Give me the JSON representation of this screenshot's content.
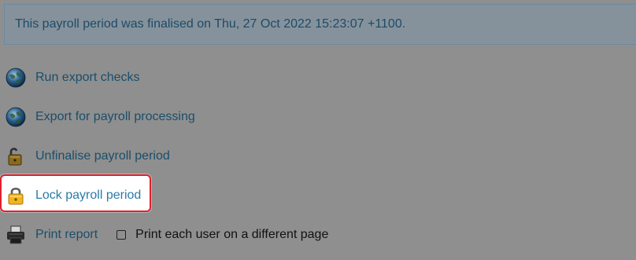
{
  "notice": {
    "text": "This payroll period was finalised on Thu, 27 Oct 2022 15:23:07 +1100."
  },
  "actions": [
    {
      "label": "Run export checks",
      "icon": "globe-icon"
    },
    {
      "label": "Export for payroll processing",
      "icon": "globe-icon"
    },
    {
      "label": "Unfinalise payroll period",
      "icon": "unlocked-padlock-icon"
    },
    {
      "label": "Lock payroll period",
      "icon": "locked-padlock-icon"
    },
    {
      "label": "Print report",
      "icon": "printer-icon"
    }
  ],
  "print_option": {
    "label": "Print each user on a different page",
    "checked": false
  },
  "colors": {
    "overlay_background": "#8f8f8f",
    "link": "#1a4e6a",
    "highlight_border": "#e0202a",
    "notice_text": "#1d4b69"
  }
}
